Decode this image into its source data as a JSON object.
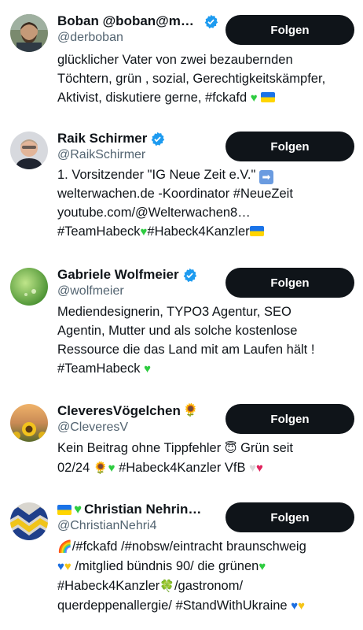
{
  "users": [
    {
      "name": "Boban @boban@mas…",
      "verified": true,
      "handle": "@derboban",
      "follow_label": "Folgen",
      "bio": [
        "glücklicher Vater von zwei bezaubernden",
        "Töchtern, grün , sozial, Gerechtigkeitskämpfer,",
        "Aktivist, diskutiere gerne, #fckafd"
      ]
    },
    {
      "name": "Raik Schirmer",
      "verified": true,
      "handle": "@RaikSchirmer",
      "follow_label": "Folgen",
      "bio": [
        "1. Vorsitzender \"IG Neue Zeit e.V.\"",
        "welterwachen.de -Koordinator #NeueZeit",
        "youtube.com/@Welterwachen8…",
        "#TeamHabeck",
        "#Habeck4Kanzler"
      ]
    },
    {
      "name": "Gabriele Wolfmeier",
      "verified": true,
      "handle": "@wolfmeier",
      "follow_label": "Folgen",
      "bio": [
        "Mediendesignerin, TYPO3 Agentur, SEO",
        "Agentin, Mutter und als solche kostenlose",
        "Ressource die das Land mit am Laufen hält !",
        "#TeamHabeck"
      ]
    },
    {
      "name": "CleveresVögelchen",
      "name_emoji": "🌻",
      "verified": false,
      "handle": "@CleveresV",
      "follow_label": "Folgen",
      "bio": [
        "Kein Beitrag ohne Tippfehler",
        "Grün seit",
        "02/24",
        "#Habeck4Kanzler VfB"
      ]
    },
    {
      "name": "Christian Nehrin…",
      "verified": false,
      "handle": "@ChristianNehri4",
      "follow_label": "Folgen",
      "bio": [
        "/#fckafd /#nobsw/eintracht braunschweig",
        "/mitglied bündnis 90/ die grünen",
        "#Habeck4Kanzler",
        "/gastronom/",
        "querdeppenallergie/ #StandWithUkraine"
      ]
    }
  ],
  "emoji": {
    "heart": "♥",
    "sunflower": "🌻",
    "halo_face": "😇",
    "clover": "🍀",
    "rainbow": "🌈",
    "arrow_right": "➡"
  },
  "colors": {
    "follow_bg": "#0f1419",
    "verified": "#1d9bf0",
    "handle": "#536471"
  }
}
